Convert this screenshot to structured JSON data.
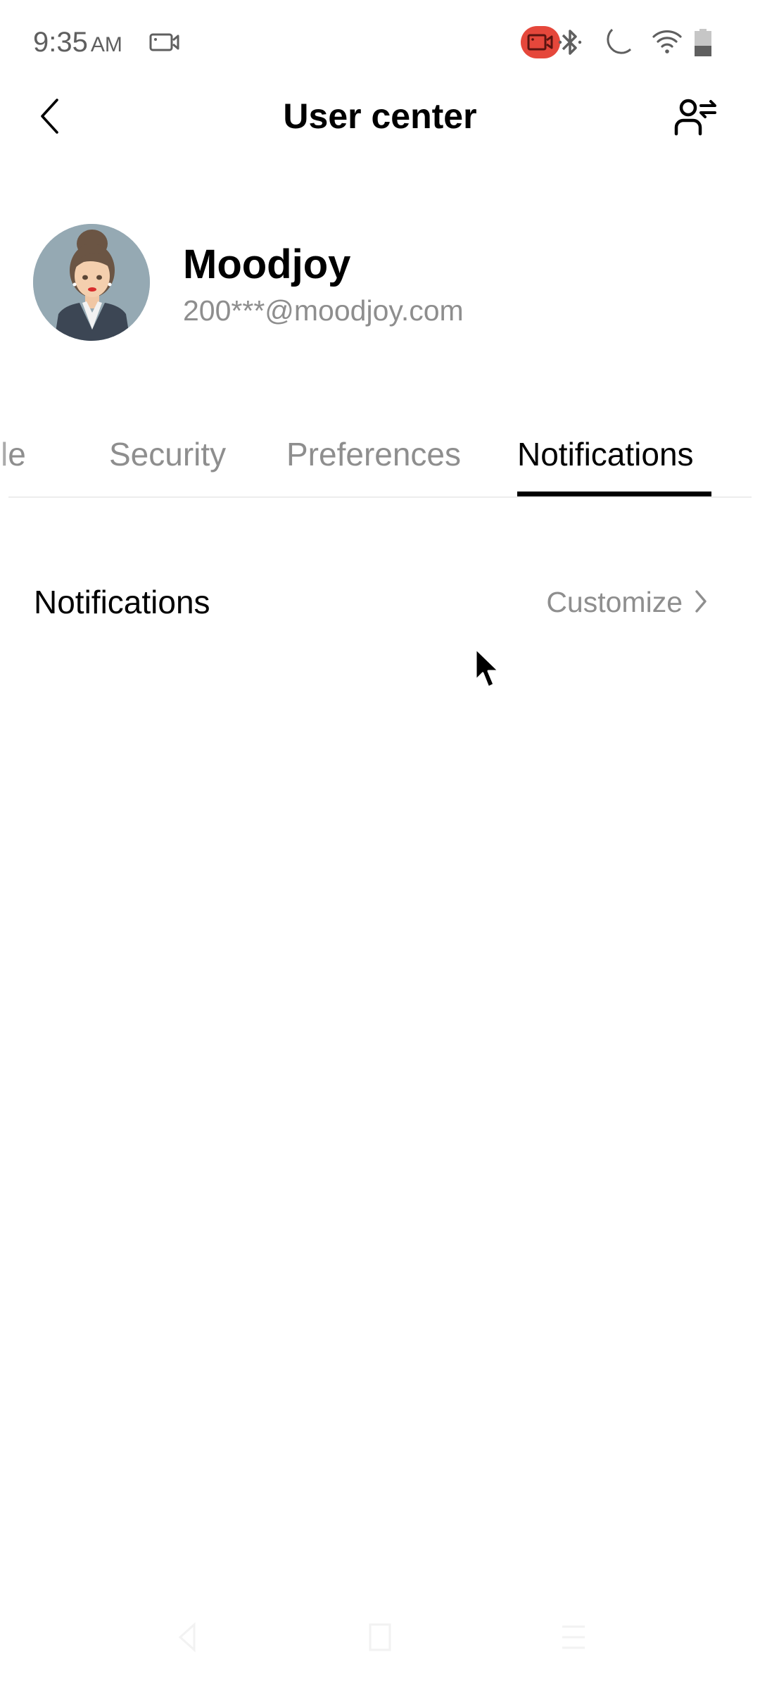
{
  "status_bar": {
    "time": "9:35",
    "ampm": "AM",
    "icons": [
      "screen-record-icon",
      "recording-active-icon",
      "bluetooth-icon",
      "do-not-disturb-moon-icon",
      "wifi-icon",
      "battery-icon"
    ],
    "recording_color": "#e5473b",
    "battery_level": 0.4
  },
  "app_bar": {
    "title": "User center",
    "back_icon": "chevron-left-icon",
    "action_icon": "switch-account-icon"
  },
  "profile": {
    "name": "Moodjoy",
    "email": "200***@moodjoy.com",
    "avatar": "avatar-woman-business-suit"
  },
  "tabs": {
    "items": [
      {
        "label": "Profile",
        "visible_label": "file",
        "active": false
      },
      {
        "label": "Security",
        "active": false
      },
      {
        "label": "Preferences",
        "active": false
      },
      {
        "label": "Notifications",
        "active": true
      }
    ],
    "active_color": "#000000",
    "inactive_color": "#8e8e8e"
  },
  "notifications_panel": {
    "rows": [
      {
        "label": "Notifications",
        "value": "Customize",
        "icon": "chevron-right-icon"
      }
    ]
  },
  "nav_bar": {
    "buttons": [
      "back-triangle-icon",
      "home-square-icon",
      "recents-menu-icon"
    ]
  }
}
